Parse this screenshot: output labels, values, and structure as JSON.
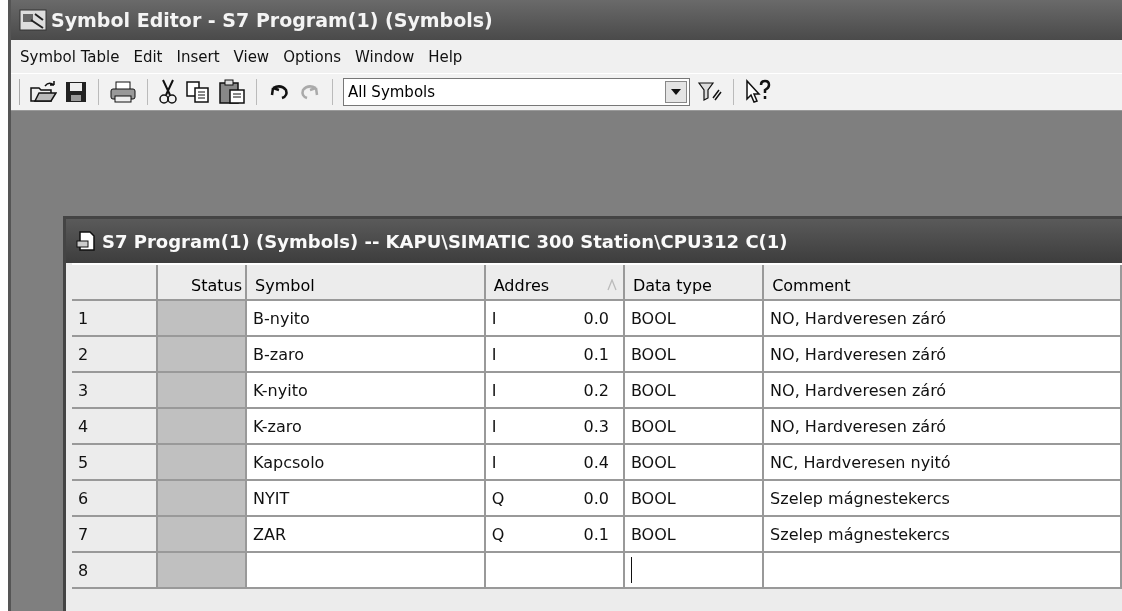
{
  "window": {
    "title": "Symbol Editor - S7 Program(1) (Symbols)"
  },
  "menu": [
    "Symbol Table",
    "Edit",
    "Insert",
    "View",
    "Options",
    "Window",
    "Help"
  ],
  "toolbar": {
    "undo": {
      "disabled": false
    },
    "redo": {
      "disabled": true
    },
    "filter": {
      "value": "All Symbols"
    }
  },
  "document": {
    "title": "S7 Program(1) (Symbols) -- KAPU\\SIMATIC 300 Station\\CPU312 C(1)"
  },
  "table": {
    "columns": [
      {
        "label": "Status",
        "sorted": false
      },
      {
        "label": "Symbol",
        "sorted": false
      },
      {
        "label": "Addres",
        "sorted": true
      },
      {
        "label": "Data type",
        "sorted": false
      },
      {
        "label": "Comment",
        "sorted": false
      }
    ],
    "rows": [
      {
        "number": "1",
        "symbol": "B-nyito",
        "area": "I",
        "address": "0.0",
        "data_type": "BOOL",
        "comment": "NO, Hardveresen záró",
        "editing": false
      },
      {
        "number": "2",
        "symbol": "B-zaro",
        "area": "I",
        "address": "0.1",
        "data_type": "BOOL",
        "comment": "NO, Hardveresen záró",
        "editing": false
      },
      {
        "number": "3",
        "symbol": "K-nyito",
        "area": "I",
        "address": "0.2",
        "data_type": "BOOL",
        "comment": "NO, Hardveresen záró",
        "editing": false
      },
      {
        "number": "4",
        "symbol": "K-zaro",
        "area": "I",
        "address": "0.3",
        "data_type": "BOOL",
        "comment": "NO, Hardveresen záró",
        "editing": false
      },
      {
        "number": "5",
        "symbol": "Kapcsolo",
        "area": "I",
        "address": "0.4",
        "data_type": "BOOL",
        "comment": "NC, Hardveresen nyitó",
        "editing": false
      },
      {
        "number": "6",
        "symbol": "NYIT",
        "area": "Q",
        "address": "0.0",
        "data_type": "BOOL",
        "comment": "Szelep mágnestekercs",
        "editing": false
      },
      {
        "number": "7",
        "symbol": "ZAR",
        "area": "Q",
        "address": "0.1",
        "data_type": "BOOL",
        "comment": "Szelep mágnestekercs",
        "editing": false
      },
      {
        "number": "8",
        "editing": true
      }
    ]
  }
}
